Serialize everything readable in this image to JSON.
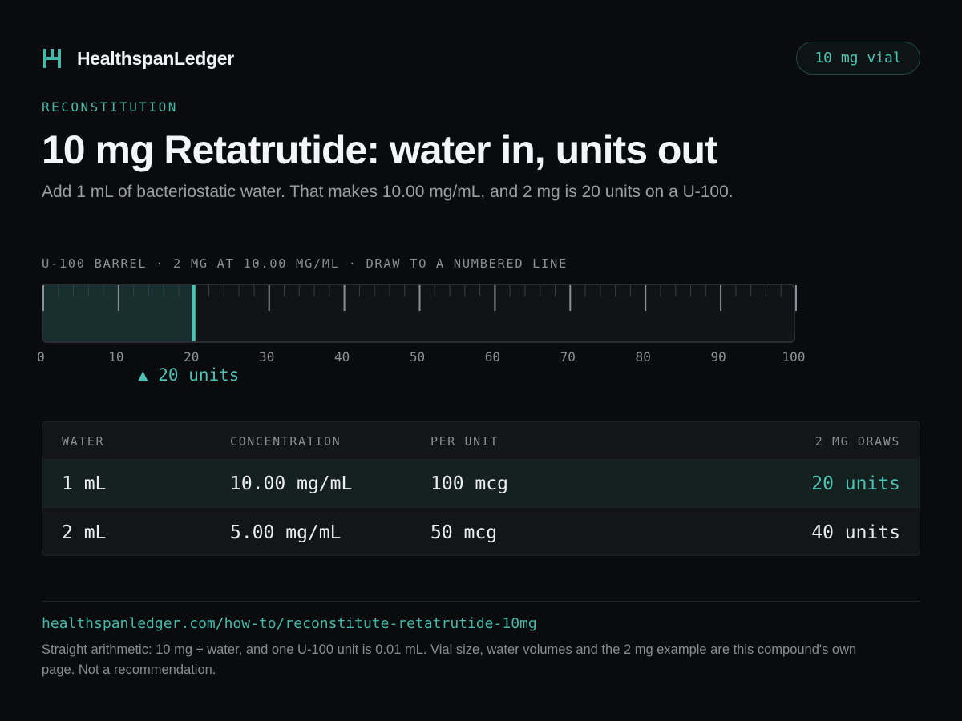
{
  "header": {
    "brand_name": "HealthspanLedger",
    "vial_badge": "10 mg vial"
  },
  "hero": {
    "eyebrow": "RECONSTITUTION",
    "title": "10 mg Retatrutide:  water in, units out",
    "subtitle": "Add 1 mL of bacteriostatic  water. That makes 10.00 mg/mL, and 2 mg is 20 units on a U-100."
  },
  "syringe": {
    "label": "U-100 BARREL · 2 MG AT 10.00 MG/ML · DRAW TO A NUMBERED LINE",
    "scale_max_units": 100,
    "fill_units": 20,
    "tick_labels": [
      "0",
      "10",
      "20",
      "30",
      "40",
      "50",
      "60",
      "70",
      "80",
      "90",
      "100"
    ],
    "pointer_text": "▲ 20 units"
  },
  "table": {
    "headers": {
      "water": "WATER",
      "concentration": "CONCENTRATION",
      "per_unit": "PER UNIT",
      "draws": "2 MG DRAWS"
    },
    "rows": [
      {
        "water": "1 mL",
        "concentration": "10.00 mg/mL",
        "per_unit": "100 mcg",
        "draws": "20 units"
      },
      {
        "water": "2 mL",
        "concentration": "5.00 mg/mL",
        "per_unit": "50 mcg",
        "draws": "40 units"
      }
    ]
  },
  "footer": {
    "url": "healthspanledger.com/how-to/reconstitute-retatrutide-10mg",
    "note": "Straight arithmetic:  10 mg ÷ water, and one U-100 unit is 0.01 mL. Vial size, water volumes and the 2 mg example  are this compound's own page. Not a recommendation."
  },
  "colors": {
    "accent": "#4cc3b5",
    "background": "#0a0b0d",
    "fill": "#17302f"
  }
}
